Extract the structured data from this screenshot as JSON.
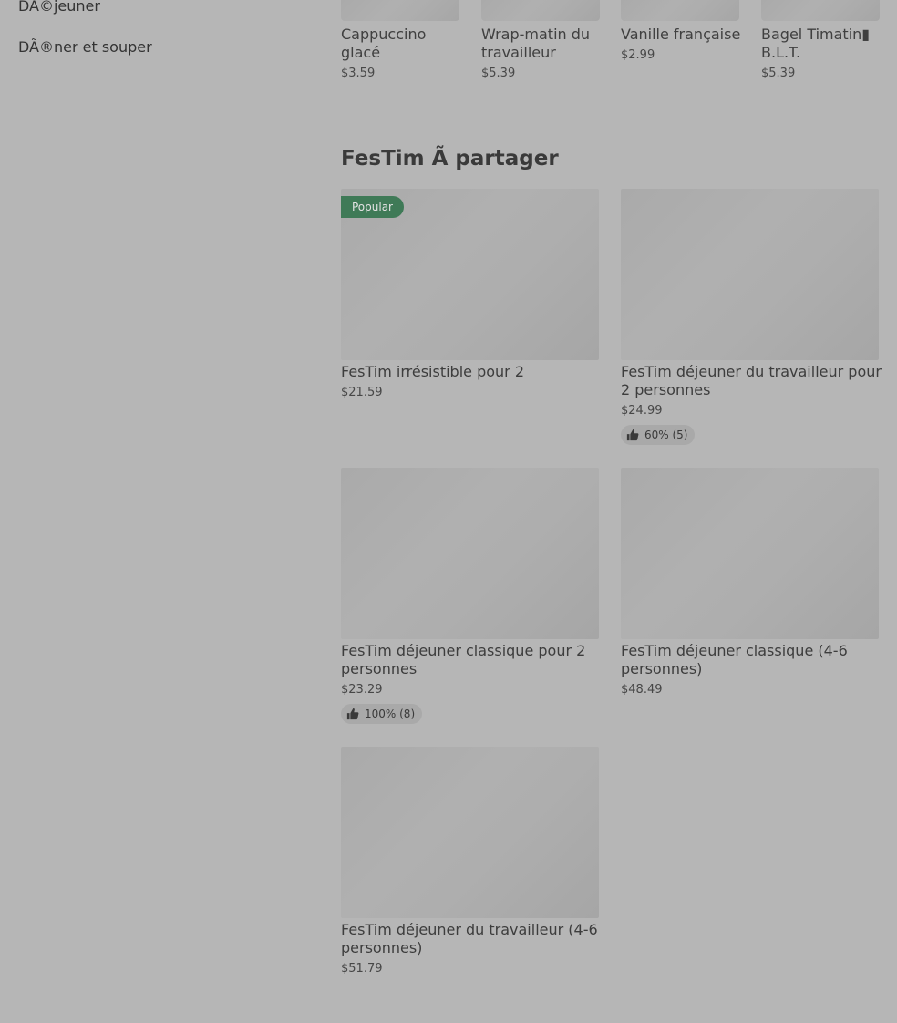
{
  "sidebar": {
    "items": [
      {
        "label": "DÃ©jeuner"
      },
      {
        "label": "DÃ®ner et souper"
      }
    ]
  },
  "top_row": [
    {
      "name": "Cappuccino glacé",
      "price": "$3.59"
    },
    {
      "name": "Wrap-matin du travailleur",
      "price": "$5.39"
    },
    {
      "name": "Vanille française",
      "price": "$2.99"
    },
    {
      "name": "Bagel Timatin▮ B.L.T.",
      "price": "$5.39"
    }
  ],
  "section": {
    "title": "FesTim Ã  partager"
  },
  "cards": [
    {
      "name": "FesTim irrésistible pour 2",
      "price": "$21.59",
      "badge": "Popular"
    },
    {
      "name": "FesTim déjeuner du travailleur pour 2 personnes",
      "price": "$24.99",
      "rating": "60% (5)"
    },
    {
      "name": "FesTim déjeuner classique pour 2 personnes",
      "price": "$23.29",
      "rating": "100% (8)"
    },
    {
      "name": "FesTim déjeuner classique (4-6 personnes)",
      "price": "$48.49"
    },
    {
      "name": "FesTim déjeuner du travailleur (4-6 personnes)",
      "price": "$51.79"
    }
  ],
  "icons": {
    "rating_icon": "thumbs-up-icon"
  }
}
